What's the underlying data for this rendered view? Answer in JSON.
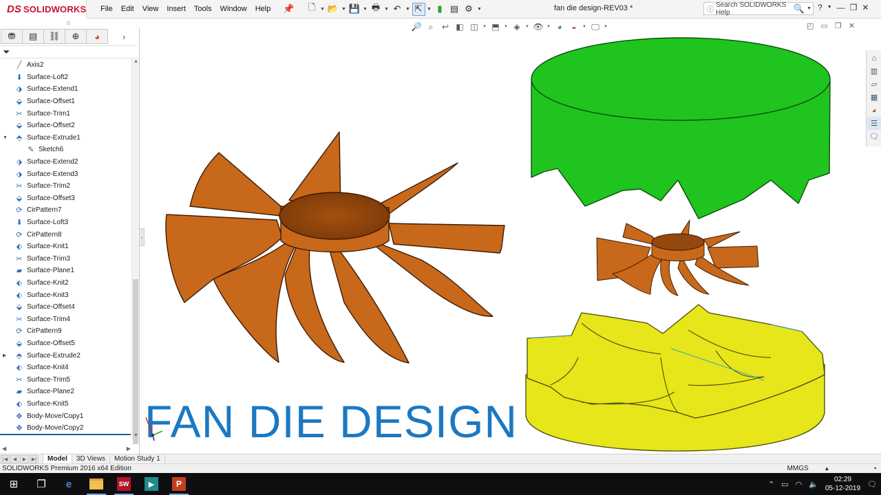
{
  "app": {
    "brand": "SOLIDWORKS",
    "brand_prefix": "DS",
    "document_title": "fan die design-REV03 *"
  },
  "menu": [
    "File",
    "Edit",
    "View",
    "Insert",
    "Tools",
    "Window",
    "Help"
  ],
  "help_search": {
    "placeholder": "Search SOLIDWORKS Help"
  },
  "feature_tree": {
    "items": [
      {
        "label": "Axis2",
        "icon": "axis-icon",
        "level": 0,
        "expand": ""
      },
      {
        "label": "Surface-Loft2",
        "icon": "loft-icon",
        "level": 0,
        "expand": ""
      },
      {
        "label": "Surface-Extend1",
        "icon": "extend-icon",
        "level": 0,
        "expand": ""
      },
      {
        "label": "Surface-Offset1",
        "icon": "offset-icon",
        "level": 0,
        "expand": ""
      },
      {
        "label": "Surface-Trim1",
        "icon": "trim-icon",
        "level": 0,
        "expand": ""
      },
      {
        "label": "Surface-Offset2",
        "icon": "offset-icon",
        "level": 0,
        "expand": ""
      },
      {
        "label": "Surface-Extrude1",
        "icon": "extrude-icon",
        "level": 0,
        "expand": "▼"
      },
      {
        "label": "Sketch6",
        "icon": "sketch-icon",
        "level": 1,
        "expand": ""
      },
      {
        "label": "Surface-Extend2",
        "icon": "extend-icon",
        "level": 0,
        "expand": ""
      },
      {
        "label": "Surface-Extend3",
        "icon": "extend-icon",
        "level": 0,
        "expand": ""
      },
      {
        "label": "Surface-Trim2",
        "icon": "trim-icon",
        "level": 0,
        "expand": ""
      },
      {
        "label": "Surface-Offset3",
        "icon": "offset-icon",
        "level": 0,
        "expand": ""
      },
      {
        "label": "CirPattern7",
        "icon": "circular-pattern-icon",
        "level": 0,
        "expand": ""
      },
      {
        "label": "Surface-Loft3",
        "icon": "loft-icon",
        "level": 0,
        "expand": ""
      },
      {
        "label": "CirPattern8",
        "icon": "circular-pattern-icon",
        "level": 0,
        "expand": ""
      },
      {
        "label": "Surface-Knit1",
        "icon": "knit-icon",
        "level": 0,
        "expand": ""
      },
      {
        "label": "Surface-Trim3",
        "icon": "trim-icon",
        "level": 0,
        "expand": ""
      },
      {
        "label": "Surface-Plane1",
        "icon": "plane-icon",
        "level": 0,
        "expand": ""
      },
      {
        "label": "Surface-Knit2",
        "icon": "knit-icon",
        "level": 0,
        "expand": ""
      },
      {
        "label": "Surface-Knit3",
        "icon": "knit-icon",
        "level": 0,
        "expand": ""
      },
      {
        "label": "Surface-Offset4",
        "icon": "offset-icon",
        "level": 0,
        "expand": ""
      },
      {
        "label": "Surface-Trim4",
        "icon": "trim-icon",
        "level": 0,
        "expand": ""
      },
      {
        "label": "CirPattern9",
        "icon": "circular-pattern-icon",
        "level": 0,
        "expand": ""
      },
      {
        "label": "Surface-Offset5",
        "icon": "offset-icon",
        "level": 0,
        "expand": ""
      },
      {
        "label": "Surface-Extrude2",
        "icon": "extrude-icon",
        "level": 0,
        "expand": "▶"
      },
      {
        "label": "Surface-Knit4",
        "icon": "knit-icon",
        "level": 0,
        "expand": ""
      },
      {
        "label": "Surface-Trim5",
        "icon": "trim-icon",
        "level": 0,
        "expand": ""
      },
      {
        "label": "Surface-Plane2",
        "icon": "plane-icon",
        "level": 0,
        "expand": ""
      },
      {
        "label": "Surface-Knit5",
        "icon": "knit-icon",
        "level": 0,
        "expand": ""
      },
      {
        "label": "Body-Move/Copy1",
        "icon": "move-copy-icon",
        "level": 0,
        "expand": ""
      },
      {
        "label": "Body-Move/Copy2",
        "icon": "move-copy-icon",
        "level": 0,
        "expand": ""
      }
    ]
  },
  "overlay": {
    "title": "FAN DIE DESIGN"
  },
  "model_colors": {
    "fan": "#c8681a",
    "top_die": "#1fc41f",
    "bottom_die": "#e6e61a"
  },
  "bottom_tabs": [
    "Model",
    "3D Views",
    "Motion Study 1"
  ],
  "status": {
    "edition": "SOLIDWORKS Premium 2016 x64 Edition",
    "units": "MMGS"
  },
  "taskbar": {
    "time": "02:29",
    "date": "05-12-2019",
    "sw_badge": "SW",
    "pp_badge": "P"
  }
}
